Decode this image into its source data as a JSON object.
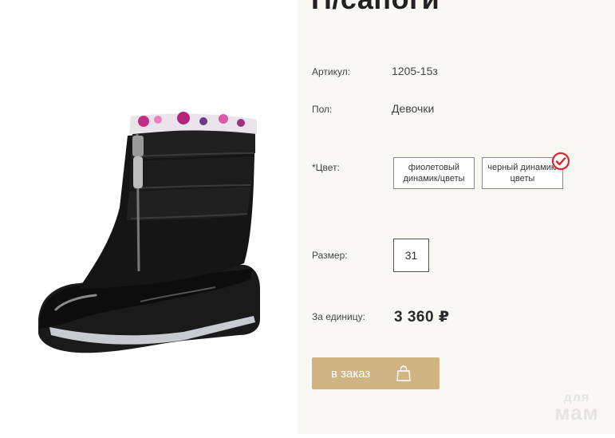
{
  "product": {
    "title": "П/сапоги",
    "image_alt": "black boot"
  },
  "details": {
    "article_label": "Артикул:",
    "article_value": "1205-15з",
    "gender_label": "Пол:",
    "gender_value": "Девочки",
    "color_label": "*Цвет:",
    "colors": [
      {
        "label": "фиолетовый\nдинамик/цветы",
        "selected": false
      },
      {
        "label": "черный динамик/\nцветы",
        "selected": true
      }
    ],
    "size_label": "Размер:",
    "size_value": "31",
    "price_label": "За единицу:",
    "price_value": "3 360 ₽"
  },
  "order": {
    "button_label": "в заказ"
  },
  "watermark": {
    "line1": "для",
    "line2": "мам"
  },
  "colors": {
    "accent": "#d0b483",
    "panel_bg": "#f9f8f3",
    "check_red": "#e0242a"
  },
  "icons": {
    "selected": "check-circle-icon",
    "cart": "shopping-bag-icon"
  }
}
